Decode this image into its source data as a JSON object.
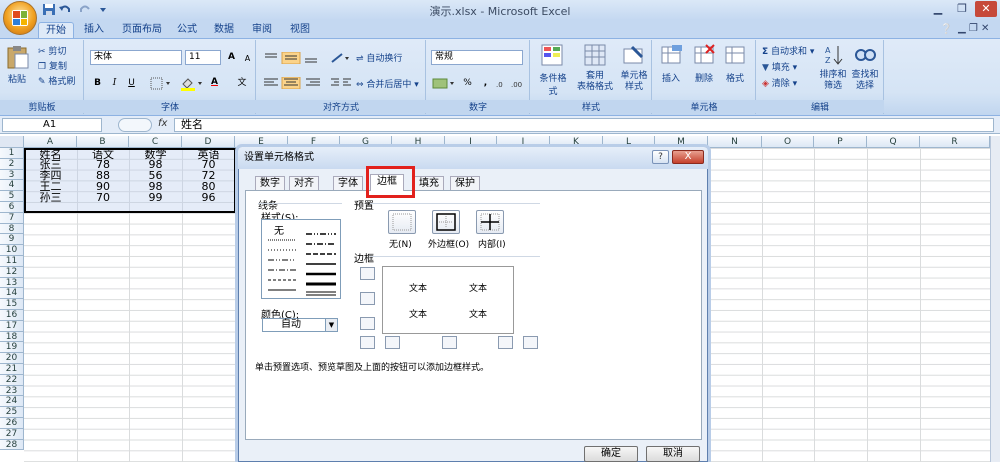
{
  "window": {
    "title": "演示.xlsx - Microsoft Excel"
  },
  "ribbon_tabs": [
    "开始",
    "插入",
    "页面布局",
    "公式",
    "数据",
    "审阅",
    "视图"
  ],
  "clipboard": {
    "paste": "粘贴",
    "cut": "剪切",
    "copy": "复制",
    "format_painter": "格式刷",
    "label": "剪贴板"
  },
  "font": {
    "name": "宋体",
    "size": "11",
    "bold": "B",
    "italic": "I",
    "underline": "U",
    "grow": "A",
    "shrink": "A",
    "font_color": "A",
    "phonetic": "文",
    "label": "字体"
  },
  "alignment": {
    "wrap": "自动换行",
    "merge": "合并后居中",
    "label": "对齐方式"
  },
  "number": {
    "format": "常规",
    "percent": "%",
    "comma": ",",
    "label": "数字"
  },
  "styles": {
    "conditional": "条件格式",
    "table": "套用\n表格格式",
    "cell_styles": "单元格\n样式",
    "label": "样式"
  },
  "cells": {
    "insert": "插入",
    "delete": "删除",
    "format": "格式",
    "label": "单元格"
  },
  "editing": {
    "autosum": "自动求和",
    "fill": "填充",
    "clear": "清除",
    "sort": "排序和\n筛选",
    "find": "查找和\n选择",
    "label": "编辑"
  },
  "formula_bar": {
    "name_box": "A1",
    "fx": "fx",
    "content": "姓名"
  },
  "columns": [
    "A",
    "B",
    "C",
    "D",
    "E",
    "F",
    "G",
    "H",
    "I",
    "J",
    "K",
    "L",
    "M",
    "N",
    "O",
    "P",
    "Q",
    "R"
  ],
  "rows": [
    "1",
    "2",
    "3",
    "4",
    "5",
    "6",
    "7",
    "8",
    "9",
    "10",
    "11",
    "12",
    "13",
    "14",
    "15",
    "16",
    "17",
    "18",
    "19",
    "20",
    "21",
    "22",
    "23",
    "24",
    "25",
    "26",
    "27",
    "28"
  ],
  "table": [
    [
      "姓名",
      "语文",
      "数学",
      "英语"
    ],
    [
      "张三",
      "78",
      "98",
      "70"
    ],
    [
      "李四",
      "88",
      "56",
      "72"
    ],
    [
      "王二",
      "90",
      "98",
      "80"
    ],
    [
      "孙三",
      "70",
      "99",
      "96"
    ]
  ],
  "dialog": {
    "title": "设置单元格格式",
    "help": "?",
    "close": "X",
    "tabs": [
      "数字",
      "对齐",
      "字体",
      "边框",
      "填充",
      "保护"
    ],
    "line_section": "线条",
    "style_label": "样式(S):",
    "none_style": "无",
    "color_label": "颜色(C):",
    "color_value": "自动",
    "presets_label": "预置",
    "preset_none": "无(N)",
    "preset_outline": "外边框(O)",
    "preset_inside": "内部(I)",
    "border_label": "边框",
    "preview_text": "文本",
    "hint": "单击预置选项、预览草图及上面的按钮可以添加边框样式。",
    "ok": "确定",
    "cancel": "取消"
  },
  "colors": {
    "highlight": "#e2211c",
    "ribbon": "#dfeaf8",
    "accent": "#15428b"
  }
}
